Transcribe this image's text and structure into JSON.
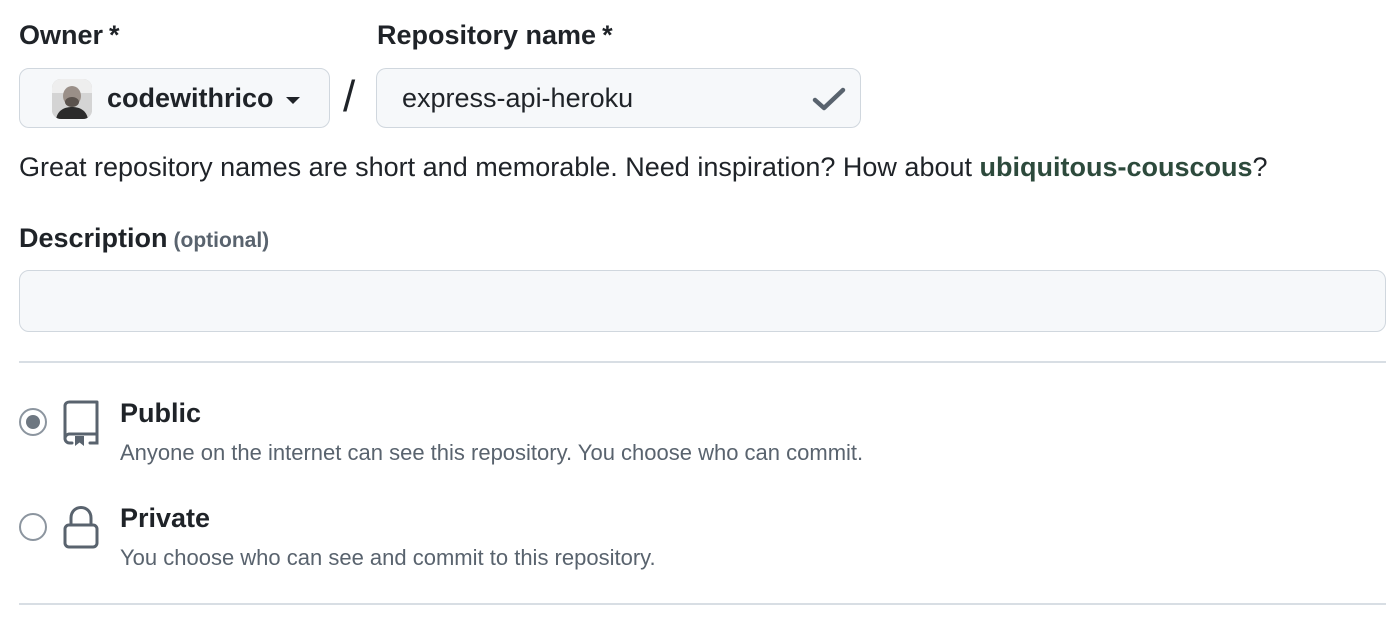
{
  "owner": {
    "label": "Owner",
    "required_marker": "*",
    "selected": "codewithrico"
  },
  "separator": "/",
  "repository": {
    "label": "Repository name",
    "required_marker": "*",
    "value": "express-api-heroku"
  },
  "hint": {
    "prefix": "Great repository names are short and memorable. Need inspiration? How about ",
    "suggestion": "ubiquitous-couscous",
    "suffix": "?"
  },
  "description": {
    "label": "Description",
    "optional_text": "(optional)",
    "value": ""
  },
  "visibility": {
    "options": [
      {
        "title": "Public",
        "description": "Anyone on the internet can see this repository. You choose who can commit.",
        "icon": "repo-icon",
        "selected": true
      },
      {
        "title": "Private",
        "description": "You choose who can see and commit to this repository.",
        "icon": "lock-icon",
        "selected": false
      }
    ]
  },
  "colors": {
    "suggestion": "#2d4a3c",
    "muted_text": "#59636e",
    "border": "#d0d7de",
    "input_bg": "#f6f8fa"
  }
}
